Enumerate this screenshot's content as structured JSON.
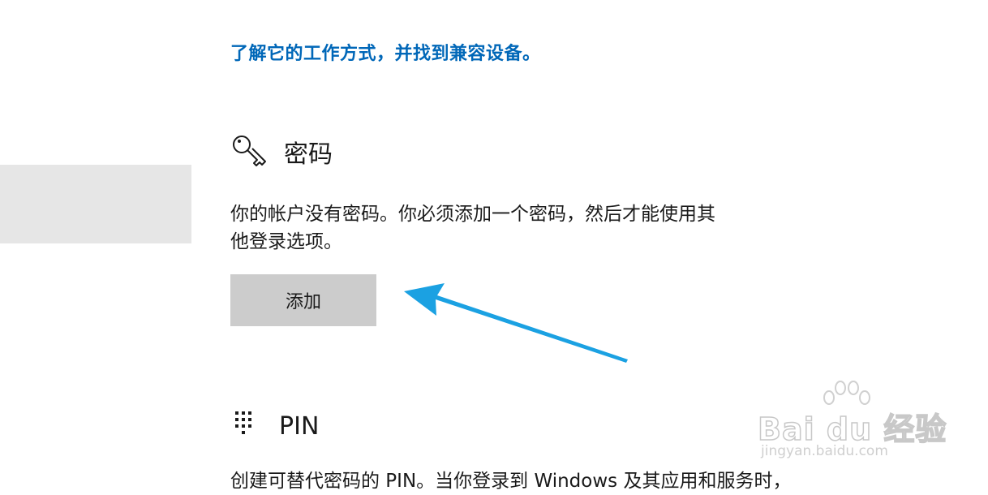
{
  "link": {
    "text": "了解它的工作方式，并找到兼容设备。"
  },
  "password_section": {
    "icon": "key-icon",
    "title": "密码",
    "description": "你的帐户没有密码。你必须添加一个密码，然后才能使用其他登录选项。",
    "add_button": "添加"
  },
  "pin_section": {
    "icon": "keypad-icon",
    "title": "PIN",
    "description": "创建可替代密码的 PIN。当你登录到 Windows 及其应用和服务时，"
  },
  "watermark": {
    "brand": "Bai du 经验",
    "url": "jingyan.baidu.com"
  },
  "colors": {
    "link": "#0067b8",
    "arrow": "#1ba1e2",
    "button": "#cccccc",
    "side_panel": "#e6e6e6"
  }
}
